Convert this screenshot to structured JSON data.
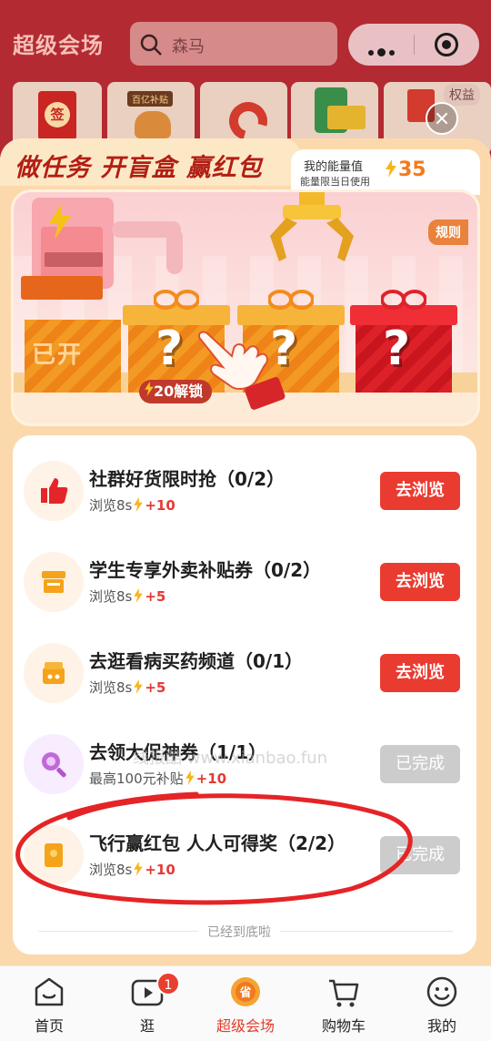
{
  "header": {
    "brand": "超级会场",
    "search_placeholder": "森马",
    "equity_label": "权益"
  },
  "panel": {
    "title": "做任务 开盲盒 赢红包",
    "energy_label": "我的能量值",
    "energy_note": "能量限当日使用",
    "energy_value": "35",
    "rules_label": "规则",
    "opened_label": "已开",
    "unlock_cost": "20",
    "unlock_label": "解锁"
  },
  "tasks": [
    {
      "title": "社群好货限时抢（0/2）",
      "sub": "浏览8s",
      "points": "+10",
      "button": "去浏览",
      "done": false,
      "icon": "thumbs-up-icon"
    },
    {
      "title": "学生专享外卖补贴券（0/2）",
      "sub": "浏览8s",
      "points": "+5",
      "button": "去浏览",
      "done": false,
      "icon": "store-icon"
    },
    {
      "title": "去逛看病买药频道（0/1）",
      "sub": "浏览8s",
      "points": "+5",
      "button": "去浏览",
      "done": false,
      "icon": "medicine-box-icon"
    },
    {
      "title": "去领大促神券（1/1）",
      "sub": "最高100元补贴",
      "points": "+10",
      "button": "已完成",
      "done": true,
      "icon": "magnifier-icon"
    },
    {
      "title": "飞行赢红包 人人可得奖（2/2）",
      "sub": "浏览8s",
      "points": "+10",
      "button": "已完成",
      "done": true,
      "icon": "red-packet-icon"
    }
  ],
  "tasks_footer": "已经到底啦",
  "watermark": "线报酷 www.xianbao.fun",
  "nav": [
    {
      "label": "首页",
      "icon": "home-icon"
    },
    {
      "label": "逛",
      "icon": "video-icon",
      "badge": "1"
    },
    {
      "label": "超级会场",
      "icon": "super-venue-icon",
      "active": true
    },
    {
      "label": "购物车",
      "icon": "cart-icon"
    },
    {
      "label": "我的",
      "icon": "profile-icon"
    }
  ],
  "colors": {
    "header_bg": "#b32a32",
    "panel_bg": "#fcd9ad",
    "button_red": "#ea3b30",
    "button_done": "#cccccc",
    "energy_orange": "#f37a1b",
    "active_nav": "#e23c2a"
  }
}
